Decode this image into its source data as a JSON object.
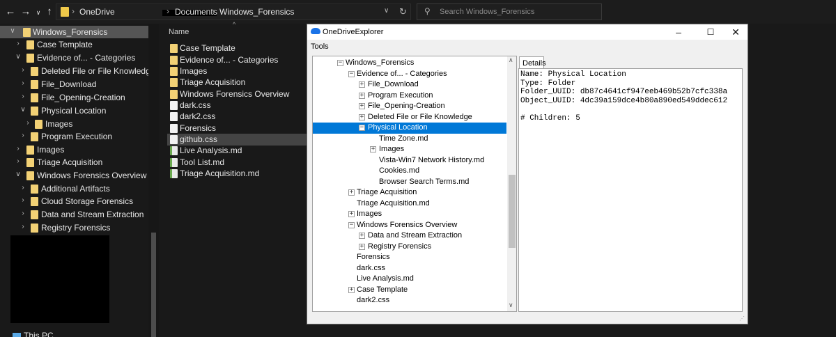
{
  "explorer": {
    "address": {
      "root": "OneDrive",
      "path": [
        "Documents",
        "Windows_Forensics"
      ]
    },
    "search_placeholder": "Search Windows_Forensics",
    "file_header": "Name",
    "nav": [
      {
        "label": "Windows_Forensics",
        "expanded": true,
        "selected": true
      },
      {
        "label": "Case Template",
        "expanded": false
      },
      {
        "label": "Evidence of... - Categories",
        "expanded": true
      },
      {
        "label": "Deleted File or File Knowledge",
        "expanded": false
      },
      {
        "label": "File_Download",
        "expanded": false
      },
      {
        "label": "File_Opening-Creation",
        "expanded": false
      },
      {
        "label": "Physical Location",
        "expanded": true
      },
      {
        "label": "Images",
        "expanded": false
      },
      {
        "label": "Program Execution",
        "expanded": false
      },
      {
        "label": "Images",
        "expanded": false
      },
      {
        "label": "Triage Acquisition",
        "expanded": false
      },
      {
        "label": "Windows Forensics Overview",
        "expanded": true
      },
      {
        "label": "Additional Artifacts",
        "expanded": false
      },
      {
        "label": "Cloud Storage Forensics",
        "expanded": false
      },
      {
        "label": "Data and Stream Extraction",
        "expanded": false
      },
      {
        "label": "Registry Forensics",
        "expanded": false
      }
    ],
    "this_pc": "This PC",
    "files": [
      {
        "name": "Case Template",
        "kind": "folder"
      },
      {
        "name": "Evidence of... - Categories",
        "kind": "folder"
      },
      {
        "name": "Images",
        "kind": "folder"
      },
      {
        "name": "Triage Acquisition",
        "kind": "folder"
      },
      {
        "name": "Windows Forensics Overview",
        "kind": "folder"
      },
      {
        "name": "dark.css",
        "kind": "doc"
      },
      {
        "name": "dark2.css",
        "kind": "doc"
      },
      {
        "name": "Forensics",
        "kind": "doc"
      },
      {
        "name": "github.css",
        "kind": "doc",
        "selected": true
      },
      {
        "name": "Live Analysis.md",
        "kind": "md"
      },
      {
        "name": "Tool List.md",
        "kind": "md"
      },
      {
        "name": "Triage Acquisition.md",
        "kind": "md"
      }
    ]
  },
  "onedrive": {
    "title": "OneDriveExplorer",
    "menu": [
      "Tools"
    ],
    "tree": [
      {
        "label": "Windows_Forensics",
        "toggle": "−"
      },
      {
        "label": "Evidence of... - Categories",
        "toggle": "−"
      },
      {
        "label": "File_Download",
        "toggle": "+"
      },
      {
        "label": "Program Execution",
        "toggle": "+"
      },
      {
        "label": "File_Opening-Creation",
        "toggle": "+"
      },
      {
        "label": "Deleted File or File Knowledge",
        "toggle": "+"
      },
      {
        "label": "Physical Location",
        "toggle": "−",
        "selected": true
      },
      {
        "label": "Time Zone.md",
        "toggle": ""
      },
      {
        "label": "Images",
        "toggle": "+"
      },
      {
        "label": "Vista-Win7 Network History.md",
        "toggle": ""
      },
      {
        "label": "Cookies.md",
        "toggle": ""
      },
      {
        "label": "Browser Search Terms.md",
        "toggle": ""
      },
      {
        "label": "Triage Acquisition",
        "toggle": "+"
      },
      {
        "label": "Triage Acquisition.md",
        "toggle": ""
      },
      {
        "label": "Images",
        "toggle": "+"
      },
      {
        "label": "Windows Forensics Overview",
        "toggle": "−"
      },
      {
        "label": "Data and Stream Extraction",
        "toggle": "+"
      },
      {
        "label": "Registry Forensics",
        "toggle": "+"
      },
      {
        "label": "Forensics",
        "toggle": ""
      },
      {
        "label": "dark.css",
        "toggle": ""
      },
      {
        "label": "Live Analysis.md",
        "toggle": ""
      },
      {
        "label": "Case Template",
        "toggle": "+"
      },
      {
        "label": "dark2.css",
        "toggle": ""
      }
    ],
    "details_tab": "Details",
    "details": [
      "Name: Physical Location",
      "Type: Folder",
      "Folder_UUID: db87c4641cf947eeb469b52b7cfc338a",
      "Object_UUID: 4dc39a159dce4b80a890ed549ddec612",
      "",
      "# Children: 5"
    ]
  }
}
